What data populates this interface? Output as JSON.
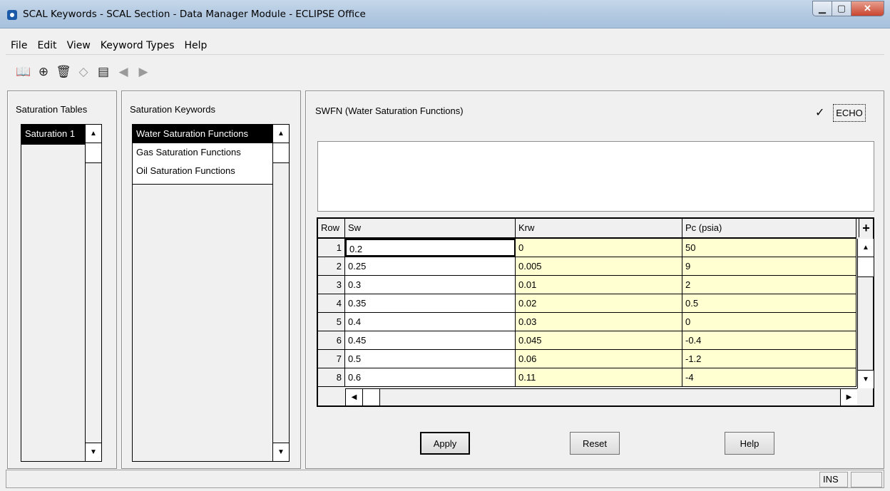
{
  "window": {
    "title": "SCAL Keywords - SCAL Section - Data Manager Module - ECLIPSE Office",
    "minimize": "▁",
    "maximize": "▢",
    "close": "✕"
  },
  "menu": [
    "File",
    "Edit",
    "View",
    "Keyword Types",
    "Help"
  ],
  "toolbar": [
    {
      "icon": "book-icon",
      "glyph": "📖",
      "enabled": true
    },
    {
      "icon": "crosshair-icon",
      "glyph": "⊕",
      "enabled": true
    },
    {
      "icon": "delete-icon",
      "glyph": "🗑",
      "enabled": true
    },
    {
      "icon": "eraser-icon",
      "glyph": "◇",
      "enabled": false
    },
    {
      "icon": "view-icon",
      "glyph": "▤",
      "enabled": true
    },
    {
      "icon": "back-icon",
      "glyph": "◀",
      "enabled": false
    },
    {
      "icon": "forward-icon",
      "glyph": "▶",
      "enabled": false
    }
  ],
  "saturation_tables": {
    "label": "Saturation Tables",
    "items": [
      "Saturation 1"
    ]
  },
  "saturation_keywords": {
    "label": "Saturation Keywords",
    "items": [
      "Water Saturation Functions",
      "Gas Saturation Functions",
      "Oil Saturation Functions"
    ]
  },
  "editor": {
    "heading": "SWFN (Water Saturation Functions)",
    "echo_label": "ECHO",
    "echo_checked": "✓",
    "columns": [
      "Row",
      "Sw",
      "Krw",
      "Pc (psia)"
    ],
    "add_symbol": "+",
    "rows": [
      {
        "row": "1",
        "sw": "0.2",
        "krw": "0",
        "pc": "50"
      },
      {
        "row": "2",
        "sw": "0.25",
        "krw": "0.005",
        "pc": "9"
      },
      {
        "row": "3",
        "sw": "0.3",
        "krw": "0.01",
        "pc": "2"
      },
      {
        "row": "4",
        "sw": "0.35",
        "krw": "0.02",
        "pc": "0.5"
      },
      {
        "row": "5",
        "sw": "0.4",
        "krw": "0.03",
        "pc": "0"
      },
      {
        "row": "6",
        "sw": "0.45",
        "krw": "0.045",
        "pc": "-0.4"
      },
      {
        "row": "7",
        "sw": "0.5",
        "krw": "0.06",
        "pc": "-1.2"
      },
      {
        "row": "8",
        "sw": "0.6",
        "krw": "0.11",
        "pc": "-4"
      }
    ]
  },
  "buttons": {
    "apply": "Apply",
    "reset": "Reset",
    "help": "Help"
  },
  "status": {
    "ins": "INS"
  }
}
